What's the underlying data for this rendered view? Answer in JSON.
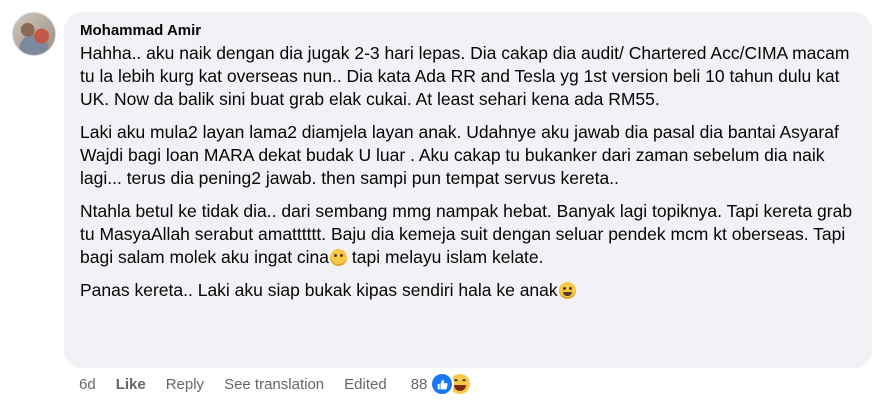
{
  "comment": {
    "author": "Mohammad Amir",
    "paragraphs": [
      "Hahha.. aku naik dengan dia jugak 2-3 hari lepas. Dia cakap dia audit/ Chartered Acc/CIMA macam tu la lebih kurg kat overseas nun.. Dia kata Ada RR and Tesla yg 1st version beli 10 tahun dulu kat UK. Now da balik sini buat grab elak cukai. At least sehari kena ada RM55.",
      "Laki aku mula2 layan lama2 diamjela layan anak. Udahnye aku jawab dia pasal dia bantai Asyaraf Wajdi bagi loan MARA dekat budak U luar . Aku cakap tu bukanker dari zaman sebelum dia naik lagi... terus dia pening2 jawab. then sampi pun tempat servus kereta..",
      "Ntahla betul ke tidak dia.. dari sembang mmg nampak hebat. Banyak lagi topiknya. Tapi kereta grab tu MasyaAllah serabut amatttttt. Baju dia kemeja suit dengan seluar pendek mcm kt oberseas. Tapi bagi salam molek aku ingat cina",
      "tapi melayu islam kelate.",
      "Panas kereta.. Laki aku siap bukak kipas sendiri hala ke anak"
    ],
    "emoji_1": "grimacing-emoji",
    "emoji_2": "grinning-squinting-emoji"
  },
  "actions": {
    "time": "6d",
    "like": "Like",
    "reply": "Reply",
    "see_translation": "See translation",
    "edited": "Edited",
    "reaction_count": "88",
    "reactions": [
      "like-reaction-icon",
      "haha-reaction-icon"
    ]
  },
  "colors": {
    "bubble": "#f0f2f5",
    "text": "#050505",
    "meta": "#65676b",
    "like": "#1877f2"
  }
}
